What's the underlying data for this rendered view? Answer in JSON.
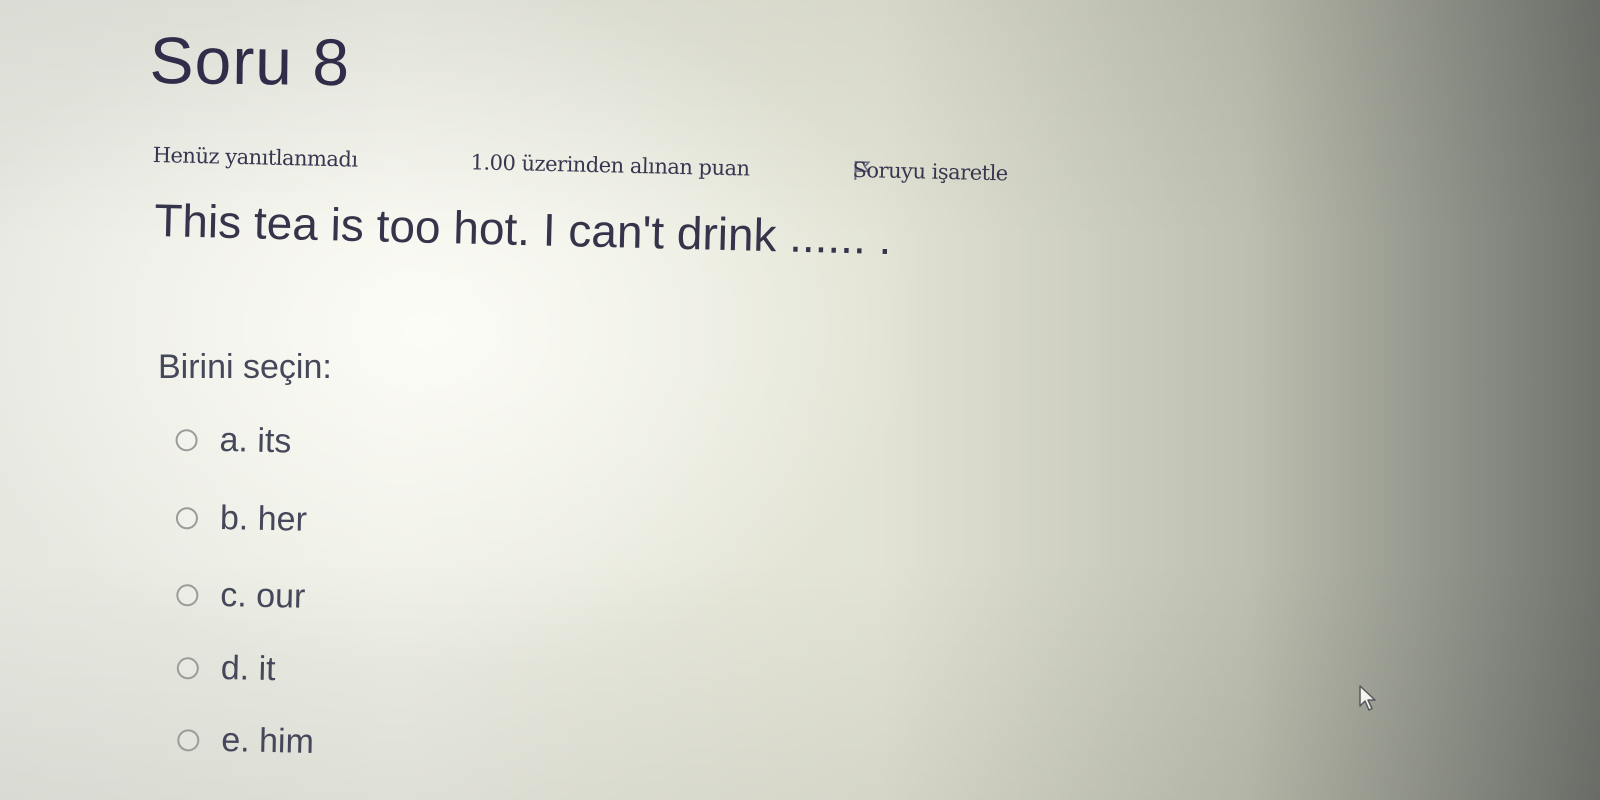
{
  "question": {
    "title": "Soru 8",
    "state": "Henüz yanıtlanmadı",
    "grade": "1.00 üzerinden alınan puan",
    "flag_label": "Soruyu işaretle",
    "text": "This tea is too hot. I can't drink ...... ."
  },
  "prompt": "Birini seçin:",
  "answers": [
    {
      "label": "a. its"
    },
    {
      "label": "b. her"
    },
    {
      "label": "c. our"
    },
    {
      "label": "d. it"
    },
    {
      "label": "e. him"
    }
  ],
  "colors": {
    "title": "#302c4a",
    "text": "#45475a",
    "radio_border": "#9a9c9a"
  },
  "icons": {
    "flag": "flag-outline-icon",
    "cursor": "mouse-pointer-icon"
  }
}
